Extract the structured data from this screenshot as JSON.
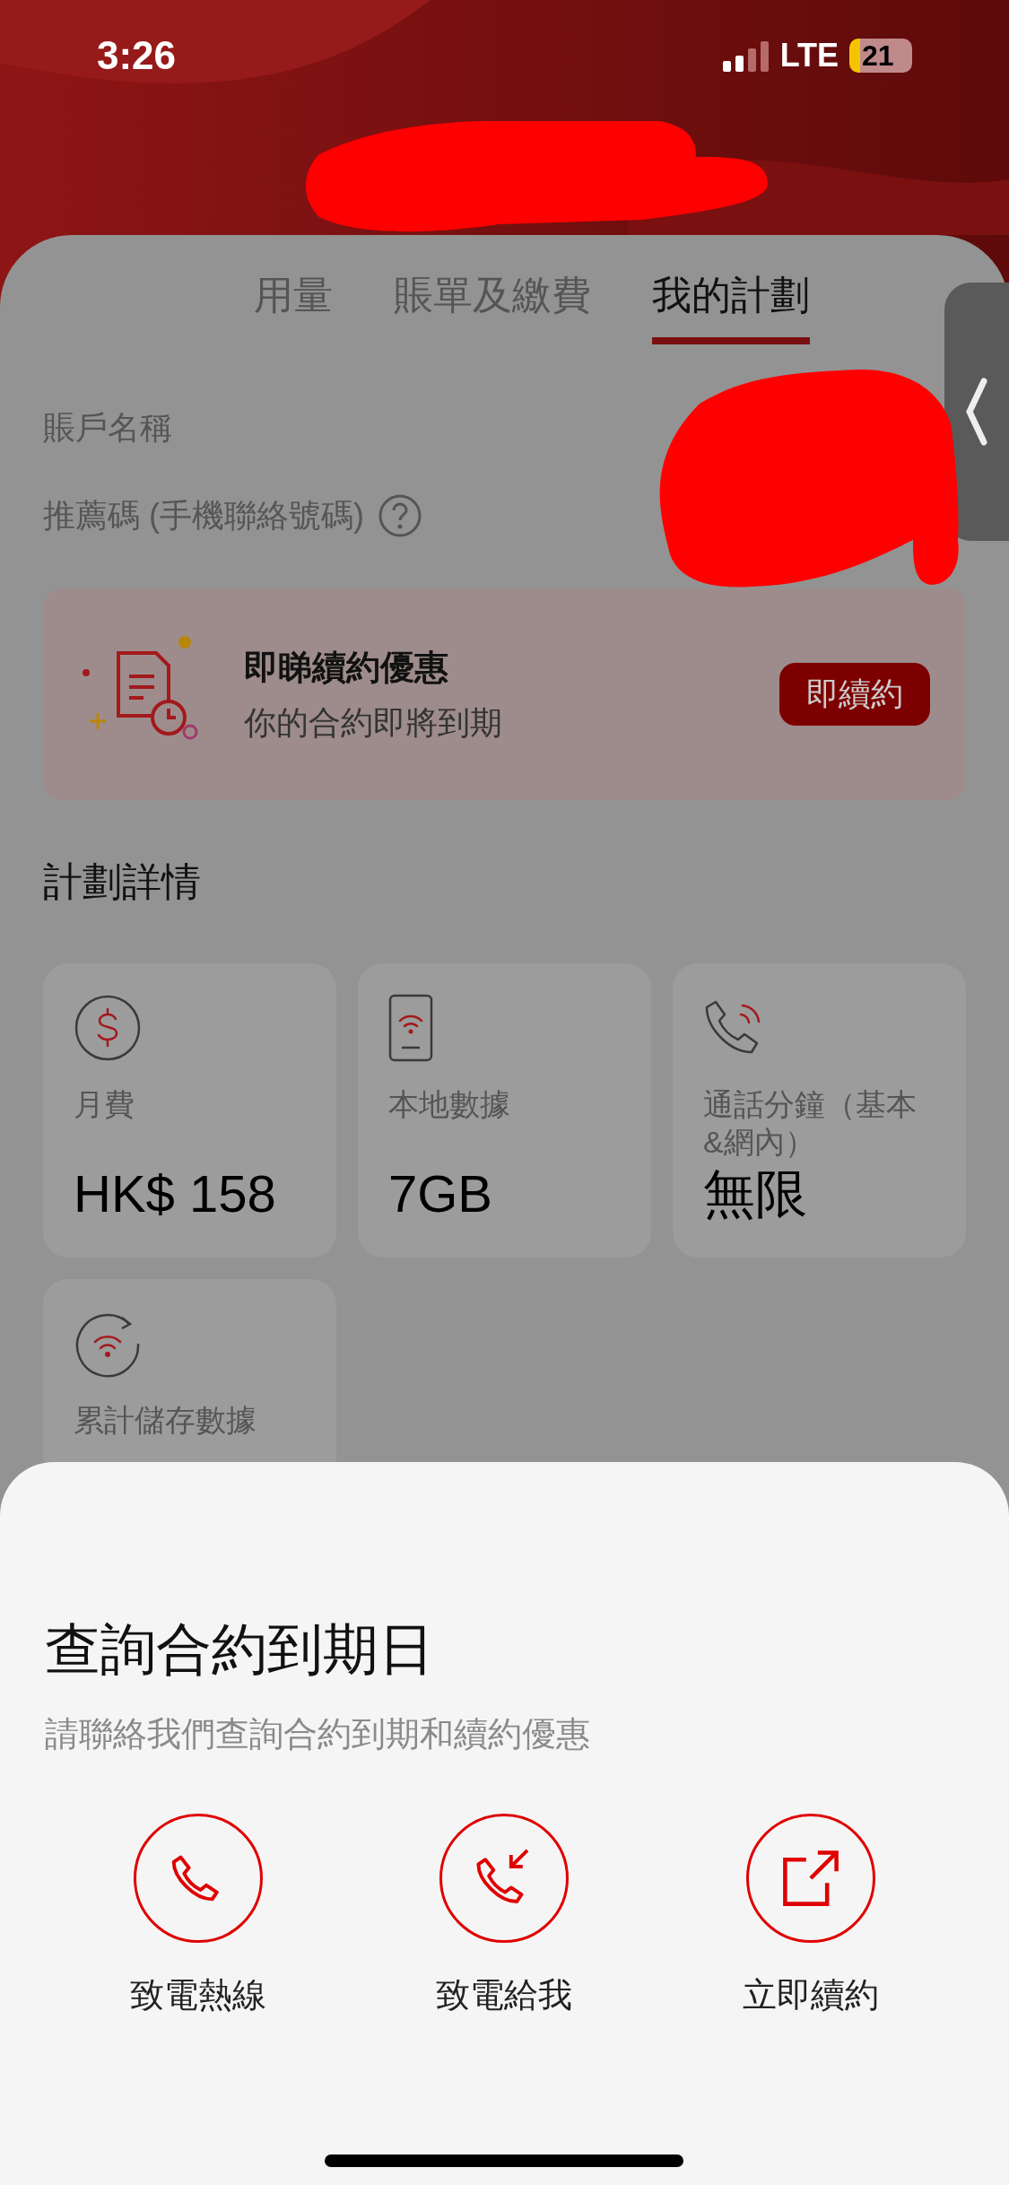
{
  "status_bar": {
    "time": "3:26",
    "network": "LTE",
    "battery": "21"
  },
  "tabs": [
    {
      "label": "用量",
      "selected": false
    },
    {
      "label": "賬單及繳費",
      "selected": false
    },
    {
      "label": "我的計劃",
      "selected": true
    }
  ],
  "account": {
    "name_label": "賬戶名稱",
    "referral_label": "推薦碼 (手機聯絡號碼)"
  },
  "promo": {
    "title": "即睇續約優惠",
    "subtitle": "你的合約即將到期",
    "button": "即續約"
  },
  "plan_section": {
    "title": "計劃詳情",
    "cards": [
      {
        "kind": "fee",
        "label": "月費",
        "value": "HK$ 158"
      },
      {
        "kind": "data",
        "label": "本地數據",
        "value": "7GB"
      },
      {
        "kind": "calls",
        "label": "通話分鐘（基本&網內）",
        "value": "無限"
      },
      {
        "kind": "stored",
        "label": "累計儲存數據"
      }
    ]
  },
  "sheet": {
    "title": "查詢合約到期日",
    "subtitle": "請聯絡我們查詢合約到期和續約優惠",
    "actions": [
      {
        "kind": "call",
        "label": "致電熱線"
      },
      {
        "kind": "callback",
        "label": "致電給我"
      },
      {
        "kind": "renew",
        "label": "立即續約"
      }
    ]
  }
}
